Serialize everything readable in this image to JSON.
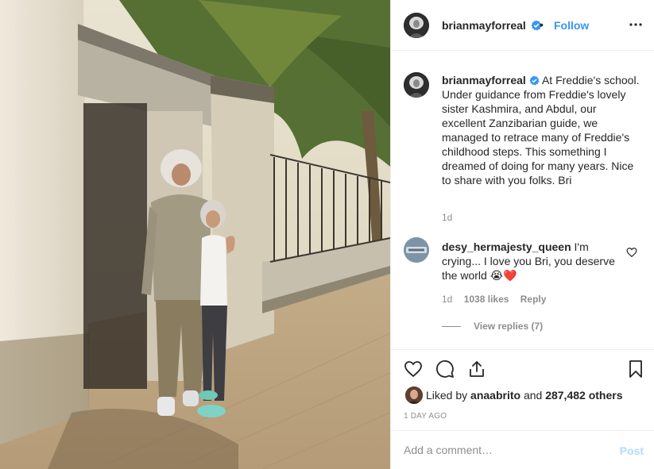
{
  "post": {
    "author": "brianmayforreal",
    "follow_label": "Follow",
    "separator": "•",
    "caption_author": "brianmayforreal",
    "caption_text": "At Freddie's school. Under guidance from Freddie's lovely sister Kashmira, and Abdul, our excellent Zanzibarian guide, we managed to retrace many of Freddie's childhood steps. This something I dreamed of doing for many years. Nice to share with you folks. Bri",
    "caption_time": "1d",
    "likes_prefix": "Liked by",
    "likes_user": "anaabrito",
    "likes_connector": "and",
    "likes_count": "287,482 others",
    "date": "1 DAY AGO"
  },
  "comments": [
    {
      "author": "desy_hermajesty_queen",
      "text": "I'm crying... I love you Bri, you deserve the world 😭❤️",
      "time": "1d",
      "likes": "1038 likes",
      "reply_label": "Reply",
      "view_replies": "View replies (7)"
    }
  ],
  "add_comment": {
    "placeholder": "Add a comment…",
    "post_label": "Post"
  },
  "icons": {
    "verified": "verified-badge-icon",
    "more": "more-options-icon",
    "like": "heart-icon",
    "comment": "comment-icon",
    "share": "share-icon",
    "save": "bookmark-icon"
  },
  "colors": {
    "accent": "#3897f0",
    "verified": "#3897f0",
    "post_disabled": "#b3dbff",
    "muted": "#8e8e8e"
  }
}
